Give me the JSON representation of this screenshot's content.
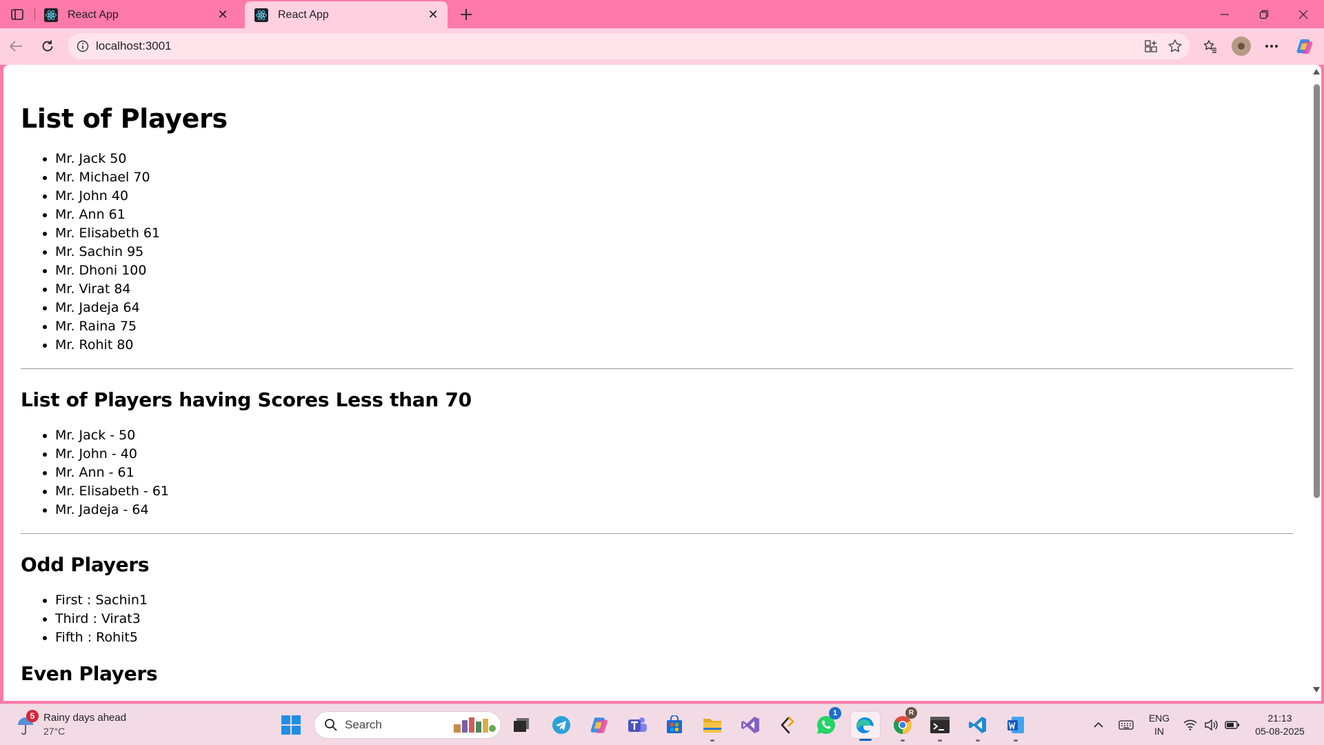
{
  "browser": {
    "tabs": [
      {
        "title": "React App",
        "active": false
      },
      {
        "title": "React App",
        "active": true
      }
    ],
    "url": "localhost:3001",
    "accent": "#ff7aa8"
  },
  "page": {
    "title": "List of Players",
    "players": [
      "Mr. Jack 50",
      "Mr. Michael 70",
      "Mr. John 40",
      "Mr. Ann 61",
      "Mr. Elisabeth 61",
      "Mr. Sachin 95",
      "Mr. Dhoni 100",
      "Mr. Virat 84",
      "Mr. Jadeja 64",
      "Mr. Raina 75",
      "Mr. Rohit 80"
    ],
    "low_title": "List of Players having Scores Less than 70",
    "low_players": [
      "Mr. Jack - 50",
      "Mr. John - 40",
      "Mr. Ann - 61",
      "Mr. Elisabeth - 61",
      "Mr. Jadeja - 64"
    ],
    "odd_title": "Odd Players",
    "odd_players": [
      "First : Sachin1",
      "Third : Virat3",
      "Fifth : Rohit5"
    ],
    "even_title": "Even Players"
  },
  "taskbar": {
    "weather": {
      "badge": "5",
      "title": "Rainy days ahead",
      "temp": "27°C"
    },
    "search_placeholder": "Search",
    "whatsapp_badge": "1",
    "chrome_badge": "R",
    "lang": {
      "line1": "ENG",
      "line2": "IN"
    },
    "time": "21:13",
    "date": "05-08-2025"
  }
}
